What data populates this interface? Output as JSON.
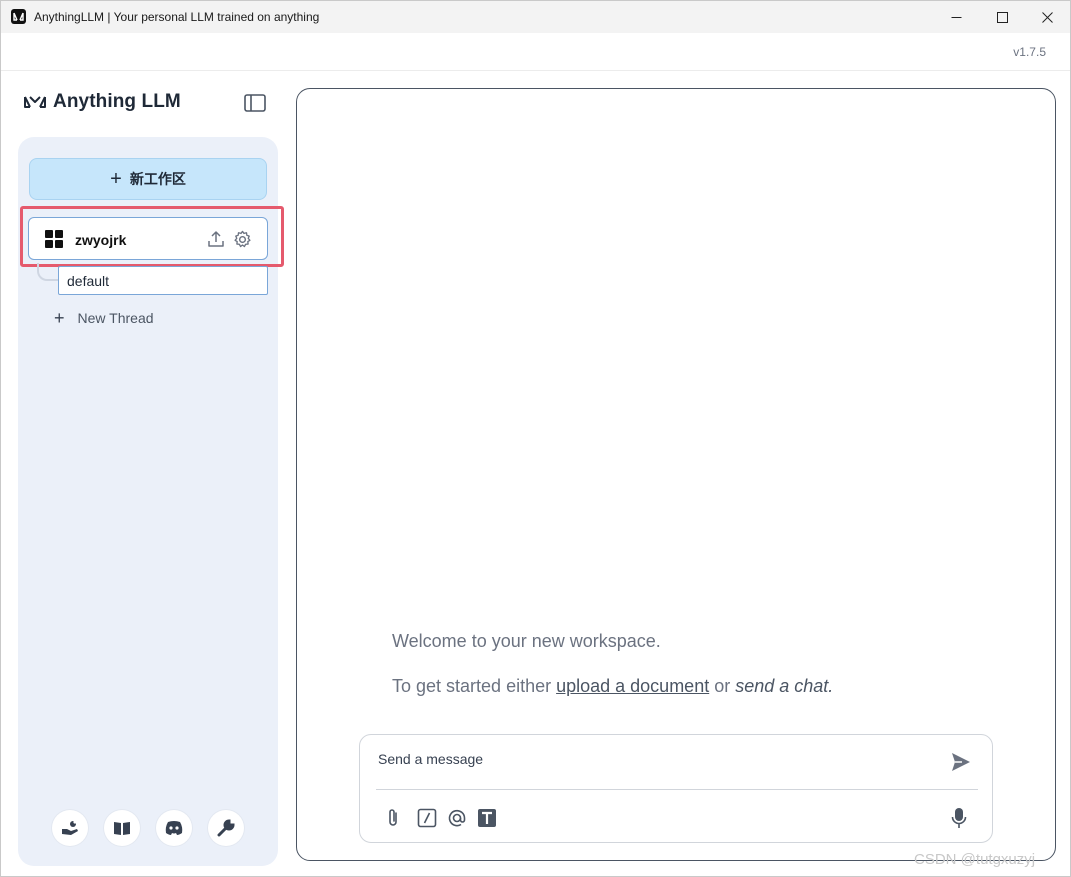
{
  "window": {
    "title": "AnythingLLM | Your personal LLM trained on anything",
    "version": "v1.7.5"
  },
  "brand": {
    "name": "Anything LLM"
  },
  "sidebar": {
    "new_workspace_label": "新工作区",
    "workspace": {
      "name": "zwyojrk",
      "highlight_color": "#e55a6d"
    },
    "threads": [
      {
        "label": "default"
      }
    ],
    "new_thread_label": "New Thread",
    "footer_icons": [
      "community-hub-icon",
      "docs-book-icon",
      "discord-icon",
      "settings-wrench-icon"
    ]
  },
  "main": {
    "welcome_text": "Welcome to your new workspace.",
    "getstarted_prefix": "To get started either ",
    "getstarted_link": "upload a document",
    "getstarted_middle": " or ",
    "getstarted_em": "send a chat.",
    "composer": {
      "placeholder": "Send a message"
    }
  },
  "watermark": "CSDN @tutgxuzyj",
  "colors": {
    "accent_button": "#c6e6fb",
    "sidebar_bg": "#ebf0f9"
  }
}
